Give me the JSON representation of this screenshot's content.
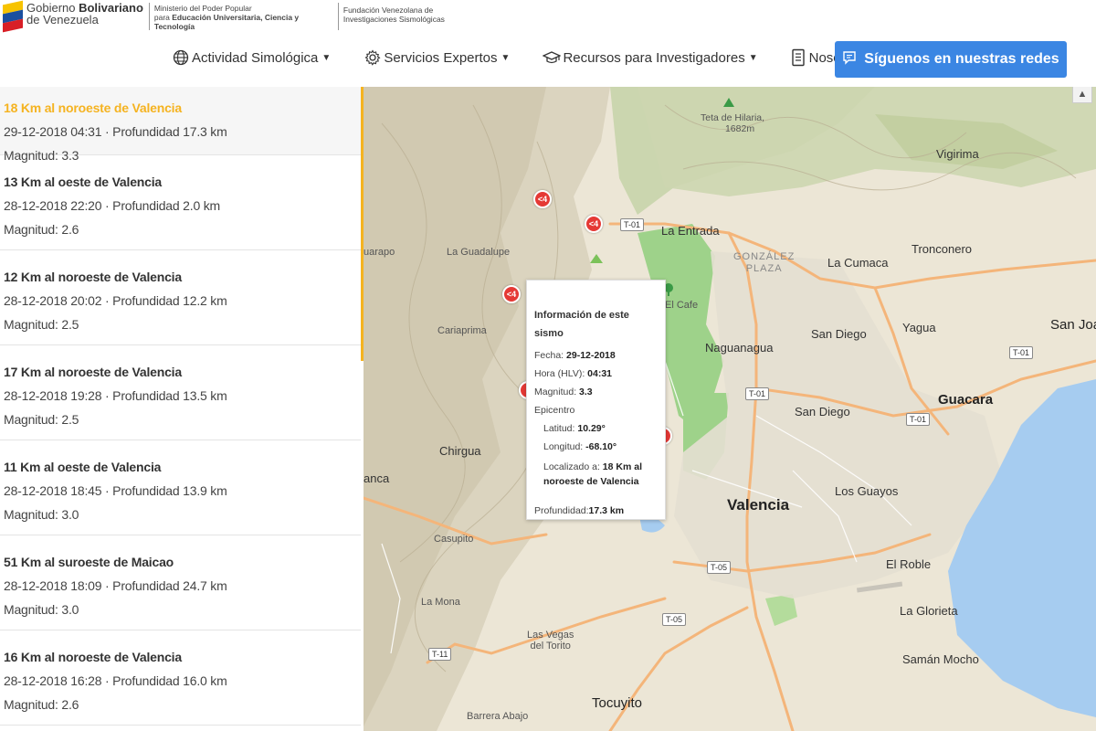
{
  "header": {
    "gov_line1_prefix": "Gobierno ",
    "gov_line1_bold": "Bolivariano",
    "gov_line2": "de Venezuela",
    "ministry_line1": "Ministerio del Poder Popular",
    "ministry_line2_prefix": "para ",
    "ministry_line2_bold": "Educación Universitaria, Ciencia y Tecnología",
    "fundacion_line1": "Fundación Venezolana de",
    "fundacion_line2": "Investigaciones Sismológicas"
  },
  "nav": {
    "items": [
      {
        "label": "Actividad Simológica",
        "icon": "globe-icon"
      },
      {
        "label": "Servicios Expertos",
        "icon": "gear-icon"
      },
      {
        "label": "Recursos para Investigadores",
        "icon": "graduation-cap-icon"
      },
      {
        "label": "Nosotros",
        "icon": "document-icon"
      }
    ],
    "cta_label": "Síguenos en nuestras redes",
    "cta_icon": "chat-icon",
    "colors": {
      "cta": "#3b86e3",
      "accent": "#f5b320",
      "quake": "#e53935"
    }
  },
  "events": [
    {
      "title": "18 Km al noroeste de Valencia",
      "meta": "29-12-2018 04:31 · Profundidad 17.3 km",
      "mag": "Magnitud: 3.3",
      "active": true
    },
    {
      "title": "13 Km al oeste de Valencia",
      "meta": "28-12-2018 22:20 · Profundidad 2.0 km",
      "mag": "Magnitud: 2.6"
    },
    {
      "title": "12 Km al noroeste de Valencia",
      "meta": "28-12-2018 20:02 · Profundidad 12.2 km",
      "mag": "Magnitud: 2.5"
    },
    {
      "title": "17 Km al noroeste de Valencia",
      "meta": "28-12-2018 19:28 · Profundidad 13.5 km",
      "mag": "Magnitud: 2.5"
    },
    {
      "title": "11 Km al oeste de Valencia",
      "meta": "28-12-2018 18:45 · Profundidad 13.9 km",
      "mag": "Magnitud: 3.0"
    },
    {
      "title": "51 Km al suroeste de Maicao",
      "meta": "28-12-2018 18:09 · Profundidad 24.7 km",
      "mag": "Magnitud: 3.0"
    },
    {
      "title": "16 Km al noroeste de Valencia",
      "meta": "28-12-2018 16:28 · Profundidad 16.0 km",
      "mag": "Magnitud: 2.6"
    }
  ],
  "map": {
    "places": {
      "teta": "Teta de Hilaria,",
      "teta_alt": "1682m",
      "vigirima": "Vigirima",
      "la_entrada": "La Entrada",
      "gonzalez_1": "GONZÁLEZ",
      "gonzalez_2": "PLAZA",
      "la_cumaca": "La Cumaca",
      "tronconero": "Tronconero",
      "uarapo": "uarapo",
      "la_guadalupe": "La Guadalupe",
      "el_cafe": "El Cafe",
      "san_diego_1": "San Diego",
      "yagua": "Yagua",
      "san_joa": "San Joa",
      "cariaprima": "Cariaprima",
      "naguanagua": "Naguanagua",
      "guacara": "Guacara",
      "san_diego_2": "San Diego",
      "chirgua": "Chirgua",
      "anca": "anca",
      "valencia": "Valencia",
      "los_guayos": "Los Guayos",
      "casupito": "Casupito",
      "el_roble": "El Roble",
      "la_mona": "La Mona",
      "la_glorieta": "La Glorieta",
      "las_vegas_1": "Las Vegas",
      "las_vegas_2": "del Torito",
      "saman_mocho": "Samán Mocho",
      "tocuyito": "Tocuyito",
      "barrera_abajo": "Barrera Abajo"
    },
    "roads": [
      "T-01",
      "T-01",
      "T-01",
      "T-01",
      "T-05",
      "T-05",
      "T-11"
    ],
    "quake_label": "<4",
    "popup": {
      "title": "Información de este sismo",
      "fecha_label": "Fecha: ",
      "fecha": "29-12-2018",
      "hora_label": "Hora (HLV): ",
      "hora": "04:31",
      "mag_label": "Magnitud: ",
      "mag": "3.3",
      "epicentro": "Epicentro",
      "lat_label": "Latitud: ",
      "lat": "10.29°",
      "lon_label": "Longitud: ",
      "lon": "-68.10°",
      "loc_label": "Localizado a: ",
      "loc": "18 Km al noroeste de Valencia",
      "prof_label": "Profundidad:",
      "prof": "17.3 km"
    }
  }
}
